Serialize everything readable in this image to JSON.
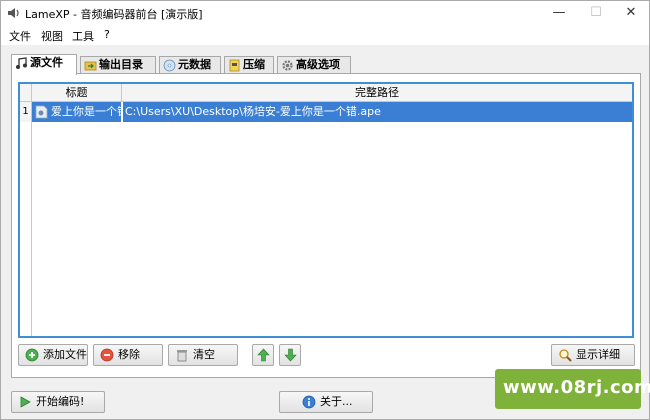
{
  "window": {
    "title": "LameXP - 音频编码器前台 [演示版]",
    "controls": {
      "minimize": "—",
      "maximize": "☐",
      "close": "✕"
    }
  },
  "menu": [
    "文件",
    "视图",
    "工具",
    "?"
  ],
  "tabs": [
    {
      "label": "源文件",
      "icon": "music-note-icon",
      "active": true
    },
    {
      "label": "输出目录",
      "icon": "folder-arrow-icon",
      "active": false
    },
    {
      "label": "元数据",
      "icon": "disc-icon",
      "active": false
    },
    {
      "label": "压缩",
      "icon": "compress-icon",
      "active": false
    },
    {
      "label": "高级选项",
      "icon": "gear-icon",
      "active": false
    }
  ],
  "table": {
    "columns": [
      "标题",
      "完整路径"
    ],
    "rows": [
      {
        "num": "1",
        "title": "爱上你是一个错",
        "path": "C:\\Users\\XU\\Desktop\\杨培安-爱上你是一个错.ape"
      }
    ]
  },
  "actions": {
    "add": "添加文件",
    "remove": "移除",
    "clear": "清空",
    "details": "显示详细"
  },
  "footer": {
    "start": "开始编码!",
    "about": "关于..."
  },
  "watermark": "www.08rj.com",
  "colors": {
    "selection": "#3b7fd4",
    "accent_border": "#3f8ed6",
    "watermark_bg": "#7fb23a"
  }
}
